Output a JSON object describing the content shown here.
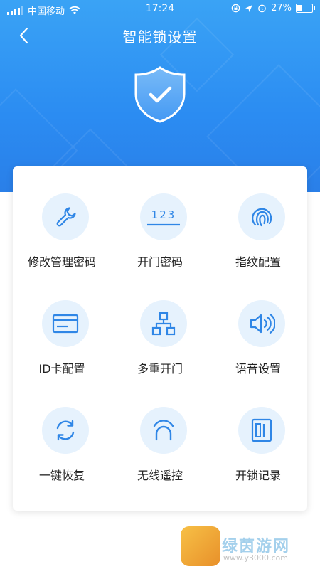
{
  "status_bar": {
    "carrier": "中国移动",
    "time": "17:24",
    "battery": "27%"
  },
  "nav": {
    "title": "智能锁设置"
  },
  "menu": {
    "items": [
      {
        "label": "修改管理密码",
        "icon": "wrench-icon"
      },
      {
        "label": "开门密码",
        "icon": "numeric-code-icon",
        "icon_text": "123"
      },
      {
        "label": "指纹配置",
        "icon": "fingerprint-icon"
      },
      {
        "label": "ID卡配置",
        "icon": "id-card-icon"
      },
      {
        "label": "多重开门",
        "icon": "hierarchy-icon"
      },
      {
        "label": "语音设置",
        "icon": "speaker-icon"
      },
      {
        "label": "一键恢复",
        "icon": "refresh-icon"
      },
      {
        "label": "无线遥控",
        "icon": "wireless-remote-icon"
      },
      {
        "label": "开锁记录",
        "icon": "record-book-icon"
      }
    ]
  },
  "colors": {
    "header_top": "#3aa3f5",
    "header_bottom": "#2a7fe8",
    "icon_blue": "#2f86e6",
    "icon_bg": "#e6f2fd"
  },
  "watermark": {
    "text": "绿茵游网",
    "sub": "www.y3000.com"
  }
}
